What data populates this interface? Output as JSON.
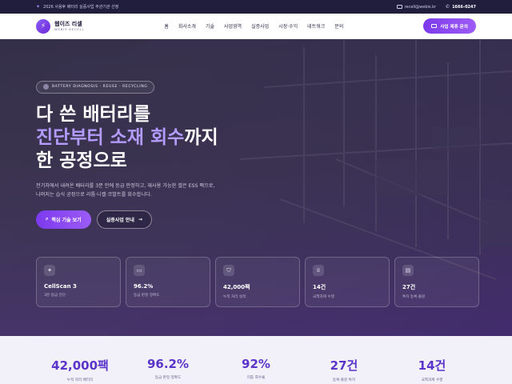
{
  "topbar": {
    "notice": "2026 사용후 배터리 실증사업 주관기관 선정",
    "email": "recell@webis.kr",
    "phone": "1666-0247"
  },
  "header": {
    "logo_ko": "웹이즈 리셀",
    "logo_en": "WEBIS RECELL",
    "nav": [
      "홈",
      "회사소개",
      "기술",
      "사업영역",
      "실증사업",
      "시장·수익",
      "네트워크",
      "문의"
    ],
    "cta": "사업 제휴 문의"
  },
  "hero": {
    "badge": "BATTERY DIAGNOSIS · REUSE · RECYCLING",
    "line1": "다 쓴 배터리를",
    "line2_accent": "진단부터 소재 회수",
    "line2_rest": "까지",
    "line3": "한 공정으로",
    "desc1": "전기차에서 내려온 배터리를 3분 안에 등급 판정하고, 재사용 가능한 셀은 ESS 팩으로,",
    "desc2": "나머지는 습식 공정으로 리튬·니켈·코발트를 회수합니다.",
    "btn_primary": "핵심 기술 보기",
    "btn_secondary": "실증사업 안내"
  },
  "cards": [
    {
      "icon": "spark-icon",
      "title": "CellScan 3",
      "sub": "3분 등급 진단"
    },
    {
      "icon": "battery-icon",
      "title": "96.2%",
      "sub": "등급 판정 정확도"
    },
    {
      "icon": "shield-icon",
      "title": "42,000팩",
      "sub": "누적 처리 실적"
    },
    {
      "icon": "trophy-icon",
      "title": "14건",
      "sub": "국책과제 수행"
    },
    {
      "icon": "document-icon",
      "title": "27건",
      "sub": "특허 등록·출원"
    }
  ],
  "stats": [
    {
      "num": "42,000팩",
      "label": "누적 처리 배터리"
    },
    {
      "num": "96.2%",
      "label": "등급 판정 정확도"
    },
    {
      "num": "92%",
      "label": "리튬 회수율"
    },
    {
      "num": "27건",
      "label": "등록·출원 특허"
    },
    {
      "num": "14건",
      "label": "국책과제 수행"
    }
  ],
  "colors": {
    "accent": "#7c3aed",
    "accent_light": "#b49bff",
    "topbar_bg": "#211d3c",
    "hero_bg": "#2e2842"
  }
}
